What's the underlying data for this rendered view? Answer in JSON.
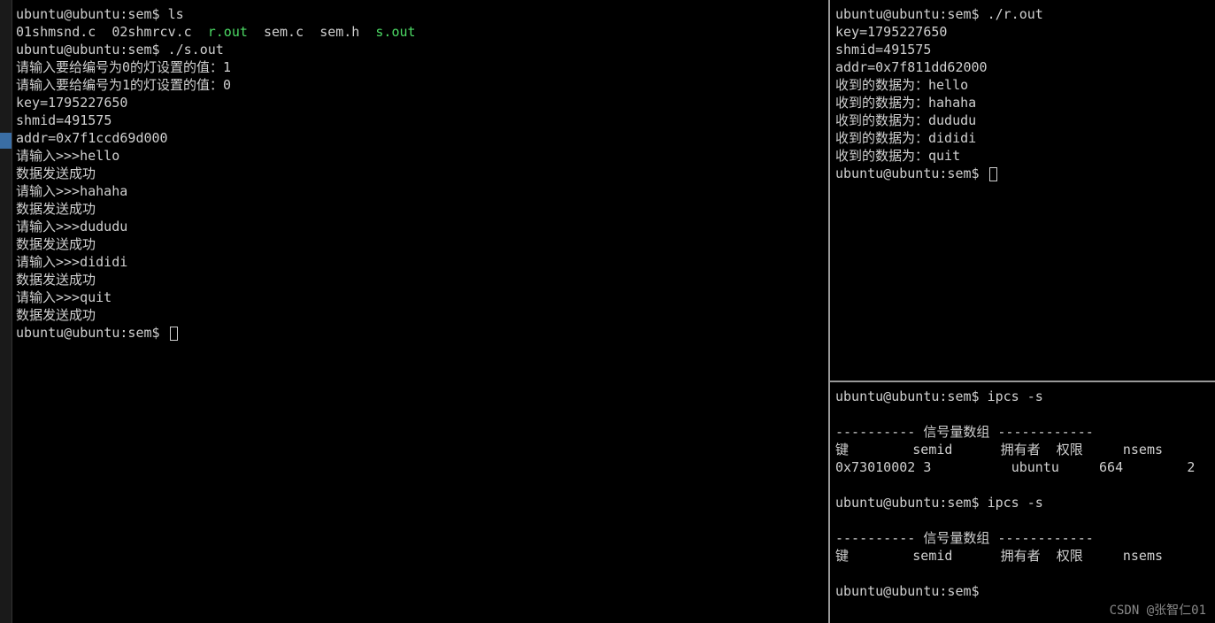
{
  "prompt": {
    "user": "ubuntu",
    "host": "ubuntu",
    "path": "sem",
    "full": "ubuntu@ubuntu:sem$ "
  },
  "left": {
    "cmd_ls": "ls",
    "ls_out": {
      "f1": "01shmsnd.c",
      "f2": "02shmrcv.c",
      "f3": "r.out",
      "f4": "sem.c",
      "f5": "sem.h",
      "f6": "s.out"
    },
    "cmd_sout": "./s.out",
    "lines": [
      "请输入要给编号为0的灯设置的值：1",
      "请输入要给编号为1的灯设置的值：0",
      "key=1795227650",
      "shmid=491575",
      "addr=0x7f1ccd69d000",
      "请输入>>>hello",
      "数据发送成功",
      "请输入>>>hahaha",
      "数据发送成功",
      "请输入>>>dududu",
      "数据发送成功",
      "请输入>>>dididi",
      "数据发送成功",
      "请输入>>>quit",
      "数据发送成功"
    ]
  },
  "right_top": {
    "cmd_rout": "./r.out",
    "lines": [
      "key=1795227650",
      "shmid=491575",
      "addr=0x7f811dd62000",
      "收到的数据为：hello",
      "收到的数据为：hahaha",
      "收到的数据为：dududu",
      "收到的数据为：dididi",
      "收到的数据为：quit"
    ]
  },
  "right_bottom": {
    "cmd_ipcs": "ipcs -s",
    "divider_prefix": "---------- ",
    "divider_label": "信号量数组",
    "divider_suffix": " ------------",
    "headers": {
      "key": "键",
      "semid": "semid",
      "owner": "拥有者",
      "perm": "权限",
      "nsems": "nsems"
    },
    "row1": {
      "key": "0x73010002",
      "semid": "3",
      "owner": "ubuntu",
      "perm": "664",
      "nsems": "2"
    }
  },
  "watermark": "CSDN @张智仁01"
}
